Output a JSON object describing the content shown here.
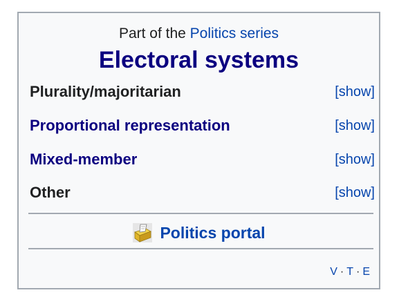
{
  "header": {
    "prefix": "Part of the ",
    "series_link": "Politics series",
    "title": "Electoral systems"
  },
  "rows": [
    {
      "label": "Plurality/majoritarian",
      "toggle": "[show]"
    },
    {
      "label": "Proportional representation",
      "toggle": "[show]"
    },
    {
      "label": "Mixed-member",
      "toggle": "[show]"
    },
    {
      "label": "Other",
      "toggle": "[show]"
    }
  ],
  "portal": {
    "label": "Politics portal",
    "icon": "ballot-box-icon"
  },
  "vte": {
    "v": "V",
    "t": "T",
    "e": "E",
    "separator": "·"
  },
  "colors": {
    "link": "#0645ad",
    "visited_link": "#0b0080",
    "text": "#202122",
    "border": "#a2a9b1",
    "background": "#f8f9fa"
  }
}
